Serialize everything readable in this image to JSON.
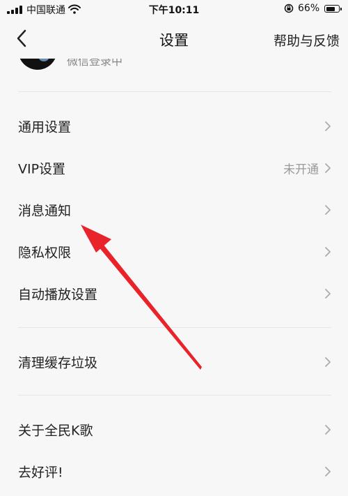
{
  "status_bar": {
    "carrier": "中国联通",
    "time": "下午10:11",
    "battery_percent": "66%"
  },
  "nav": {
    "title": "设置",
    "help": "帮助与反馈",
    "back_icon": "chevron-left-icon"
  },
  "profile": {
    "login_method": "微信登录中"
  },
  "menu": {
    "general": {
      "label": "通用设置"
    },
    "vip": {
      "label": "VIP设置",
      "value": "未开通"
    },
    "notifications": {
      "label": "消息通知"
    },
    "privacy": {
      "label": "隐私权限"
    },
    "autoplay": {
      "label": "自动播放设置"
    },
    "clear_cache": {
      "label": "清理缓存垃圾"
    },
    "about": {
      "label": "关于全民K歌"
    },
    "rate": {
      "label": "去好评!"
    }
  },
  "colors": {
    "background": "#f7f7f7",
    "annotation_arrow": "#e8232a",
    "secondary_text": "#9a9a9a"
  }
}
